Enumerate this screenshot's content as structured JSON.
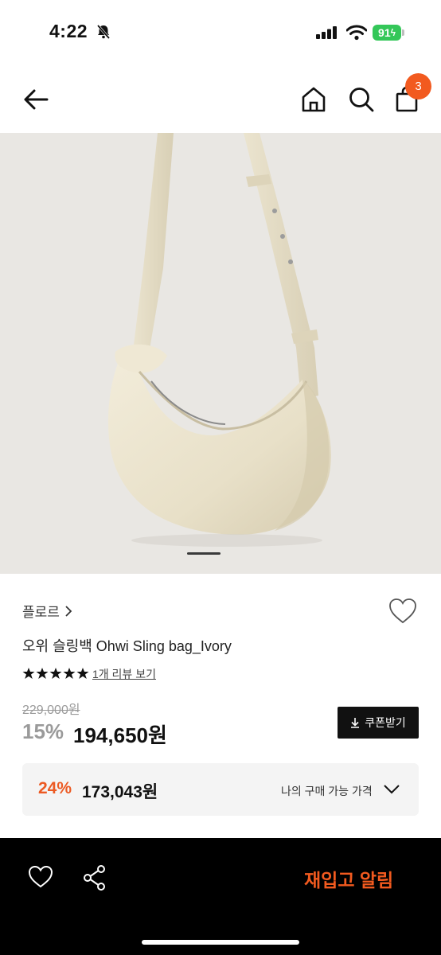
{
  "status_bar": {
    "time": "4:22",
    "battery": "91"
  },
  "header": {
    "cart_count": "3"
  },
  "product": {
    "brand": "플로르",
    "title": "오위 슬링백 Ohwi Sling bag_Ivory",
    "rating_stars": 5,
    "review_link": "1개 리뷰 보기",
    "original_price": "229,000원",
    "discount": "15%",
    "price": "194,650원",
    "coupon_button": "쿠폰받기",
    "my_price": {
      "discount": "24%",
      "price": "173,043원",
      "label": "나의 구매 가능 가격"
    }
  },
  "image_pager": {
    "current": 1
  },
  "bottom_bar": {
    "restock_label": "재입고 알림"
  },
  "colors": {
    "accent": "#f25a1f",
    "bag": "#ece6d3",
    "background_photo": "#e9e7e3"
  }
}
